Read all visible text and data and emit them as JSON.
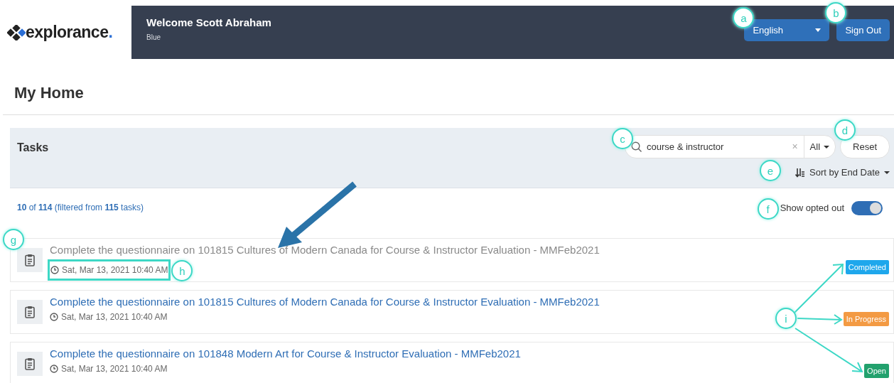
{
  "header": {
    "logo": "explorance",
    "logo_dot": ".",
    "welcome": "Welcome Scott Abraham",
    "subtitle": "Blue",
    "language": {
      "value": "English",
      "callout": "a"
    },
    "sign_out": {
      "label": "Sign Out",
      "callout": "b"
    }
  },
  "page_title": "My Home",
  "tasks_panel": {
    "title": "Tasks",
    "search": {
      "value": "course & instructor",
      "clear": "×",
      "callout": "c"
    },
    "filter": {
      "value": "All"
    },
    "reset": {
      "label": "Reset",
      "callout": "d"
    },
    "sort": {
      "label": "Sort by End Date",
      "callout": "e"
    }
  },
  "summary": "**10** of **114** (filtered from **115** tasks)",
  "opted_out_toggle": {
    "label": "Show opted out",
    "on": true,
    "callout": "f"
  },
  "tasks": [
    {
      "title": "Complete the questionnaire on 101815 Cultures of Modern Canada for Course & Instructor Evaluation - MMFeb2021",
      "date": "Sat, Mar 13, 2021 10:40 AM",
      "status": "Completed",
      "kind": "completed",
      "opted_out": true,
      "icon_callout": "g",
      "date_callout": "h"
    },
    {
      "title": "Complete the questionnaire on 101815 Cultures of Modern Canada for Course & Instructor Evaluation - MMFeb2021",
      "date": "Sat, Mar 13, 2021 10:40 AM",
      "status": "In Progress",
      "kind": "in_progress",
      "opted_out": false
    },
    {
      "title": "Complete the questionnaire on 101848 Modern Art for Course & Instructor Evaluation - MMFeb2021",
      "date": "Sat, Mar 13, 2021 10:40 AM",
      "status": "Open",
      "kind": "open",
      "opted_out": false
    }
  ],
  "status_callout": "i"
}
